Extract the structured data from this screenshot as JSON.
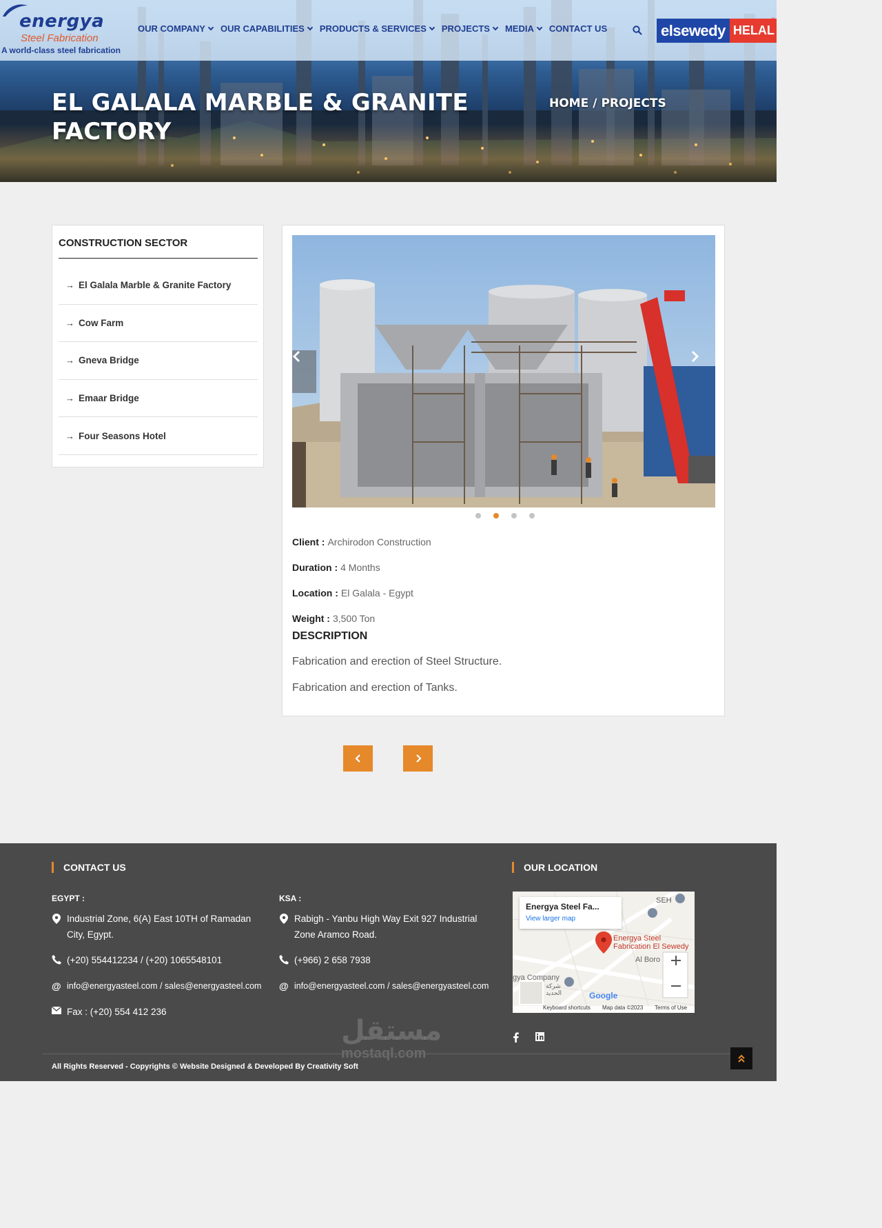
{
  "header": {
    "logo": {
      "brand": "energya",
      "sub": "Steel Fabrication",
      "tagline": "A world-class steel fabrication"
    },
    "menu": [
      {
        "label": "OUR COMPANY",
        "has_dropdown": true
      },
      {
        "label": "OUR CAPABILITIES",
        "has_dropdown": true
      },
      {
        "label": "PRODUCTS & SERVICES",
        "has_dropdown": true
      },
      {
        "label": "PROJECTS",
        "has_dropdown": true
      },
      {
        "label": "MEDIA",
        "has_dropdown": true
      },
      {
        "label": "CONTACT US",
        "has_dropdown": false
      }
    ],
    "partner": {
      "part_a": "elsewedy",
      "part_b": "HELAL",
      "reg": "®"
    }
  },
  "hero": {
    "title": "EL GALALA MARBLE & GRANITE FACTORY",
    "breadcrumb": {
      "home": "HOME",
      "sep": "/",
      "current": "PROJECTS"
    }
  },
  "sidebar": {
    "title": "CONSTRUCTION SECTOR",
    "items": [
      "El Galala Marble & Granite Factory",
      "Cow Farm",
      "Gneva Bridge",
      "Emaar Bridge",
      "Four Seasons Hotel"
    ]
  },
  "project": {
    "slider": {
      "dot_count": 4,
      "active_dot": 2
    },
    "facts": [
      {
        "label": "Client :",
        "value": "Archirodon Construction"
      },
      {
        "label": "Duration :",
        "value": "4 Months"
      },
      {
        "label": "Location :",
        "value": "El Galala - Egypt"
      },
      {
        "label": "Weight :",
        "value": "3,500 Ton"
      }
    ],
    "description_title": "DESCRIPTION",
    "description": [
      "Fabrication and erection of Steel Structure.",
      "Fabrication and erection of Tanks."
    ]
  },
  "footer": {
    "contact_title": "CONTACT US",
    "location_title": "OUR LOCATION",
    "egypt": {
      "title": "EGYPT :",
      "address": "Industrial Zone, 6(A) East 10TH of Ramadan City, Egypt.",
      "phone": "(+20) 554412234 / (+20) 1065548101",
      "email": "info@energyasteel.com / sales@energyasteel.com",
      "fax": "Fax : (+20) 554 412 236"
    },
    "ksa": {
      "title": "KSA :",
      "address": "Rabigh - Yanbu High Way Exit 927 Industrial Zone Aramco Road.",
      "phone": "(+966) 2 658 7938",
      "email": "info@energyasteel.com / sales@energyasteel.com"
    },
    "map": {
      "place": "Energya Steel Fa...",
      "larger_link": "View larger map",
      "pin_label_1": "Energya Steel",
      "pin_label_2": "Fabrication El Sewedy",
      "label_seh": "SEH",
      "label_boro": "Al Boro",
      "label_company": "gya Company",
      "label_arabic": "شركة",
      "label_arabic_2": "الحديد",
      "google": "Google",
      "kbd": "Keyboard shortcuts",
      "mapdata": "Map data ©2023",
      "terms": "Terms of Use"
    },
    "copyright": "All Rights Reserved - Copyrights © Website Designed & Developed By Creativity Soft",
    "watermark": {
      "arabic": "مستقل",
      "latin": "mostaql.com"
    }
  },
  "colors": {
    "accent": "#e5892b",
    "brand_blue": "#1f3d92",
    "footer_bg": "#4a4a4a"
  }
}
